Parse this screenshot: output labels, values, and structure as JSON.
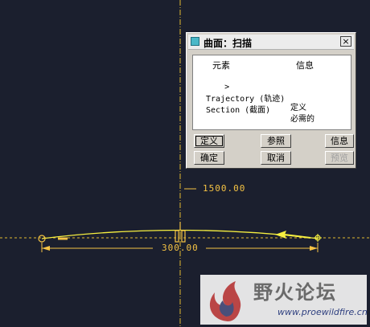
{
  "dialog": {
    "title": "曲面：扫描",
    "close_glyph": "×",
    "columns": {
      "element": "元素",
      "info": "信息"
    },
    "rows": [
      {
        "marker": ">",
        "element": "Trajectory (轨迹)",
        "info": "定义"
      },
      {
        "marker": "",
        "element": "Section (截面)",
        "info": "必需的"
      }
    ],
    "buttons": {
      "define": "定义",
      "refs": "参照",
      "info": "信息",
      "ok": "确定",
      "cancel": "取消",
      "preview": "预览"
    }
  },
  "dimensions": {
    "height": "1500.00",
    "width": "300.00"
  },
  "watermark": {
    "name": "野火论坛",
    "url": "www.proewildfire.cn"
  },
  "colors": {
    "background": "#1b1f2e",
    "axis": "#e0b830",
    "trajectory": "#f7f040",
    "dimension": "#f5c344"
  }
}
